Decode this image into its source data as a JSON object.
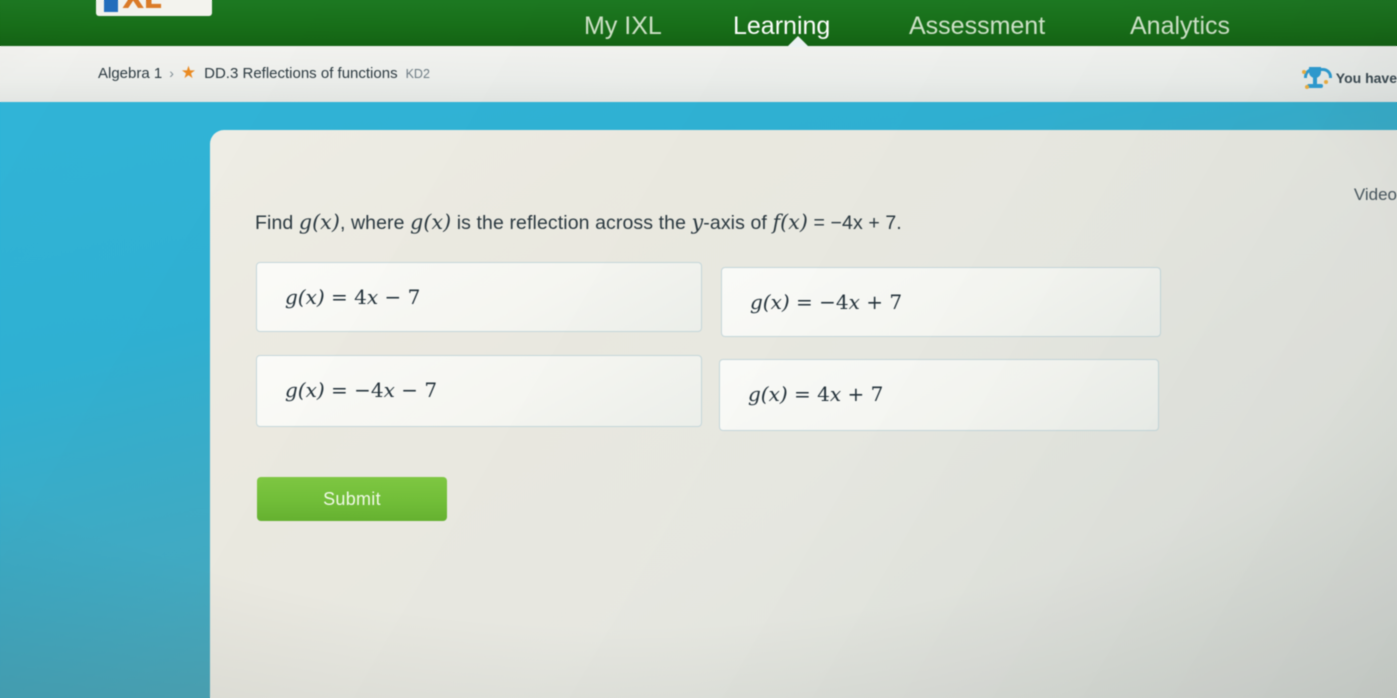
{
  "brand": {
    "logo_i": "I",
    "logo_xl": "XL",
    "green": "#157016",
    "cyan": "#2ab2d7",
    "submit_green": "#6fc032",
    "star_orange": "#ef8a1b",
    "trophy_blue": "#2a9fd8"
  },
  "topnav": {
    "items": [
      {
        "label": "My IXL",
        "active": false
      },
      {
        "label": "Learning",
        "active": true
      },
      {
        "label": "Assessment",
        "active": false
      },
      {
        "label": "Analytics",
        "active": false
      }
    ]
  },
  "breadcrumb": {
    "course": "Algebra 1",
    "separator": "›",
    "star": "★",
    "skill": "DD.3 Reflections of functions",
    "code": "KD2"
  },
  "award": {
    "text": "You have"
  },
  "content": {
    "video_label": "Video",
    "question": {
      "prefix": "Find ",
      "g1": "g(x)",
      "mid1": ", where ",
      "g2": "g(x)",
      "mid2": " is the reflection across the ",
      "axis": "y",
      "mid3": "-axis of ",
      "f": "f(x)",
      "equation": " = −4x + 7."
    },
    "choices": [
      {
        "lhs": "g(x)",
        "eq": " = 4",
        "var": "x",
        "rest": " − 7"
      },
      {
        "lhs": "g(x)",
        "eq": " = −4",
        "var": "x",
        "rest": " + 7"
      },
      {
        "lhs": "g(x)",
        "eq": " = −4",
        "var": "x",
        "rest": " − 7"
      },
      {
        "lhs": "g(x)",
        "eq": " = 4",
        "var": "x",
        "rest": " + 7"
      }
    ],
    "submit_label": "Submit"
  }
}
